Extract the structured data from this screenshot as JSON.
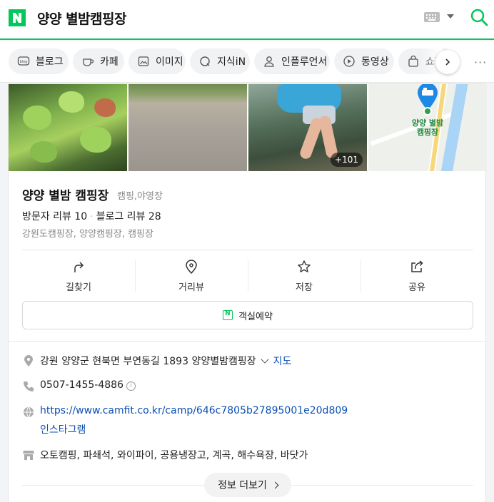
{
  "header": {
    "logo_letter": "N",
    "query": "양양 별밤캠핑장"
  },
  "tabs": [
    {
      "label": "블로그",
      "icon": "blog-icon"
    },
    {
      "label": "카페",
      "icon": "cafe-icon"
    },
    {
      "label": "이미지",
      "icon": "image-icon"
    },
    {
      "label": "지식iN",
      "icon": "kin-icon"
    },
    {
      "label": "인플루언서",
      "icon": "person-icon"
    },
    {
      "label": "동영상",
      "icon": "play-icon"
    },
    {
      "label": "쇼핑",
      "icon": "bag-icon"
    }
  ],
  "tabs_more": "···",
  "photos": {
    "more_count": "+101",
    "map_label": "양양 별밤 캠핑장"
  },
  "place": {
    "name": "양양 별밤 캠핑장",
    "category": "캠핑,야영장",
    "visitor_reviews": "방문자 리뷰 10",
    "blog_reviews": "블로그 리뷰 28",
    "tags": "강원도캠핑장, 양양캠핑장, 캠핑장"
  },
  "actions": [
    {
      "label": "길찾기",
      "icon": "directions-icon"
    },
    {
      "label": "거리뷰",
      "icon": "street-view-icon"
    },
    {
      "label": "저장",
      "icon": "star-icon"
    },
    {
      "label": "공유",
      "icon": "share-icon"
    }
  ],
  "reserve_label": "객실예약",
  "info": {
    "address": "강원 양양군 현북면 부연동길 1893 양양별밤캠핑장",
    "map_link": "지도",
    "phone": "0507-1455-4886",
    "website": "https://www.camfit.co.kr/camp/646c7805b27895001e20d809",
    "instagram": "인스타그램",
    "amenities": "오토캠핑, 파쇄석, 와이파이, 공용냉장고, 계곡, 해수욕장, 바닷가"
  },
  "more_info_label": "정보 더보기",
  "colors": {
    "brand_green": "#03c75a",
    "link_blue": "#0b4fb3",
    "pin_blue": "#1e88e5"
  }
}
